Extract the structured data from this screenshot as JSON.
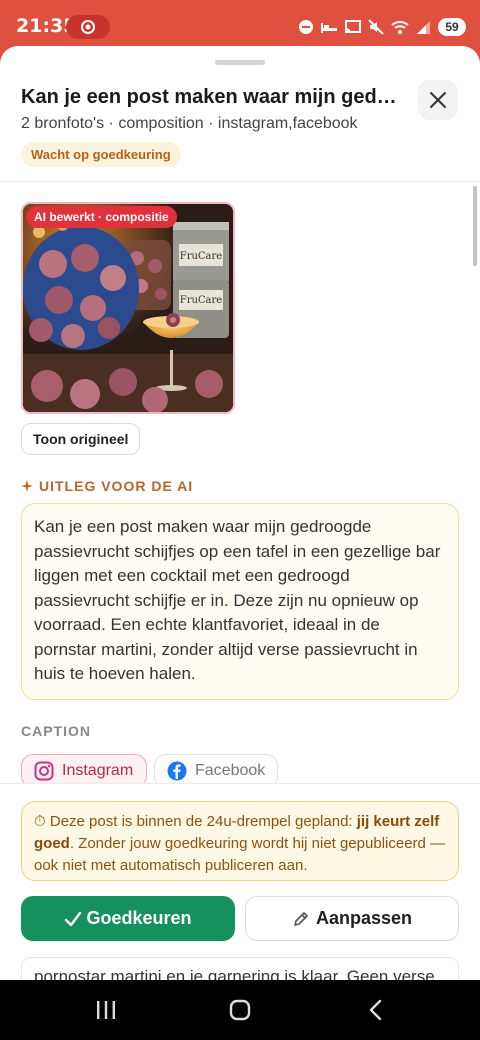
{
  "status_bar": {
    "time": "21:35",
    "battery": "59",
    "icons": [
      "record-icon",
      "do-not-disturb-icon",
      "sleep-icon",
      "cast-icon",
      "mute-icon",
      "wifi-icon",
      "signal-icon",
      "battery-icon"
    ]
  },
  "header": {
    "title": "Kan je een post maken waar mijn gedro…",
    "subtitle": "2 bronfoto's · composition · instagram,facebook",
    "status_badge": "Wacht op goedkeuring"
  },
  "image": {
    "tag": "AI bewerkt · compositie",
    "show_original_label": "Toon origineel",
    "jar_label_1": "FruCare",
    "jar_label_2": "FruCare"
  },
  "ai_section": {
    "heading": "UITLEG VOOR DE AI",
    "text": "Kan je een post maken waar mijn gedroogde passievrucht schijfjes op een tafel in een gezellige bar liggen met een cocktail met een gedroogd passievrucht schijfje er in. Deze zijn nu opnieuw op voorraad. Een echte klantfavoriet, ideaal in de pornstar martini, zonder altijd verse passievrucht in huis te hoeven halen."
  },
  "caption_section": {
    "heading": "CAPTION",
    "tabs": [
      {
        "label": "Instagram",
        "active": true
      },
      {
        "label": "Facebook",
        "active": false
      }
    ],
    "peek_text": "pornostar martini en je garnering is klaar. Geen verse"
  },
  "notice": {
    "icon": "⏱",
    "text_before": "Deze post is binnen de 24u-drempel gepland: ",
    "emphasis": "jij keurt zelf goed",
    "text_after": ". Zonder jouw goedkeuring wordt hij niet gepubliceerd — ook niet met automatisch publiceren aan."
  },
  "actions": {
    "approve_label": "Goedkeuren",
    "edit_label": "Aanpassen"
  },
  "colors": {
    "accent_red": "#e0503f",
    "approve_green": "#14915f",
    "warning_bg": "#fef8e4",
    "ai_orange": "#b7652a"
  }
}
